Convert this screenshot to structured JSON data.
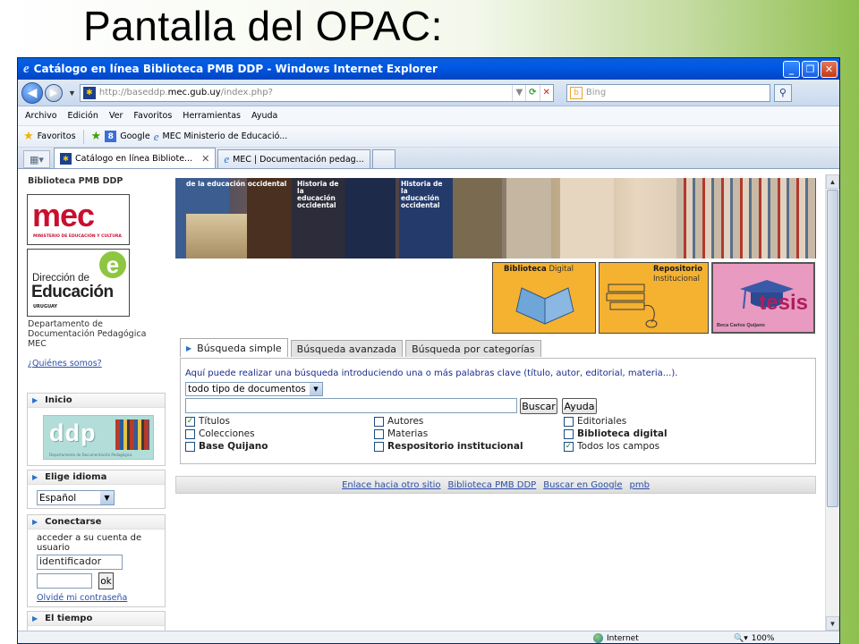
{
  "slide": {
    "title": "Pantalla del OPAC:"
  },
  "window": {
    "title": "Catálogo en línea Biblioteca PMB DDP - Windows Internet Explorer",
    "url_prefix": "http://baseddp.",
    "url_host": "mec.gub.uy",
    "url_suffix": "/index.php?",
    "search_placeholder": "Bing"
  },
  "menu": [
    "Archivo",
    "Edición",
    "Ver",
    "Favoritos",
    "Herramientas",
    "Ayuda"
  ],
  "favorites_bar": {
    "favorites_label": "Favoritos",
    "items": [
      "Google",
      "MEC  Ministerio de Educació..."
    ]
  },
  "tabs": [
    {
      "label": "Catálogo en línea Bibliote...",
      "active": true
    },
    {
      "label": "MEC | Documentación pedag...",
      "active": false
    }
  ],
  "sidebar": {
    "site_name": "Biblioteca PMB DDP",
    "mec_logo": {
      "word": "mec",
      "sub": "MINISTERIO DE EDUCACIÓN Y CULTURA"
    },
    "de_logo": {
      "line1": "Dirección de",
      "line2": "Educación",
      "sub": "URUGUAY",
      "mark": "e"
    },
    "department": "Departamento de Documentación Pedagógica MEC",
    "about_link": "¿Quiénes somos?",
    "inicio": {
      "title": "Inicio",
      "ddp_text": "ddp",
      "ddp_sub": "Departamento de Documentación Pedagógica"
    },
    "language": {
      "title": "Elige idioma",
      "selected": "Español"
    },
    "login": {
      "title": "Conectarse",
      "prompt": "acceder a su cuenta de usuario",
      "user_value": "identificador",
      "ok_label": "ok",
      "forgot_label": "Olvidé mi contraseña"
    },
    "weather": {
      "title": "El tiempo"
    }
  },
  "banner": {
    "cover_texts": [
      "de la educación occidental",
      "Historia de la educación occidental",
      "Historia de la educación occidental"
    ],
    "tiles": [
      {
        "label_bold": "Biblioteca",
        "label_rest": "Digital"
      },
      {
        "label_bold": "Repositorio",
        "label_rest": "Institucional"
      },
      {
        "label_bold": "tesis",
        "label_rest": "Beca Carlos Quijano"
      }
    ]
  },
  "search": {
    "tabs": [
      "Búsqueda simple",
      "Búsqueda avanzada",
      "Búsqueda por categorías"
    ],
    "intro": "Aquí puede realizar una búsqueda introduciendo una o más palabras clave (título, autor, editorial, materia...).",
    "doctype_selected": "todo tipo de documentos",
    "query_value": "",
    "buscar_label": "Buscar",
    "ayuda_label": "Ayuda",
    "checkboxes": [
      {
        "label": "Títulos",
        "checked": true,
        "bold": false
      },
      {
        "label": "Autores",
        "checked": false,
        "bold": false
      },
      {
        "label": "Editoriales",
        "checked": false,
        "bold": false
      },
      {
        "label": "Colecciones",
        "checked": false,
        "bold": false
      },
      {
        "label": "Materias",
        "checked": false,
        "bold": false
      },
      {
        "label": "Biblioteca digital",
        "checked": false,
        "bold": true
      },
      {
        "label": "Base Quijano",
        "checked": false,
        "bold": true
      },
      {
        "label": "Respositorio institucional",
        "checked": false,
        "bold": true
      },
      {
        "label": "Todos los campos",
        "checked": true,
        "bold": false
      }
    ]
  },
  "footer_links": [
    "Enlace hacia otro sitio",
    "Biblioteca PMB DDP",
    "Buscar en Google",
    "pmb"
  ],
  "statusbar": {
    "zone": "Internet",
    "zoom": "100%"
  },
  "colors": {
    "accent": "#2c4ea8",
    "tile_orange": "#f5b130",
    "tile_pink": "#e89ac0",
    "mec_red": "#c8102e"
  }
}
